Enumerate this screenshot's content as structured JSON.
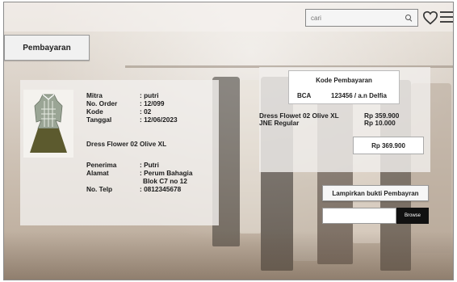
{
  "header": {
    "search_placeholder": "cari",
    "icons": [
      "search-icon",
      "heart-icon",
      "menu-icon"
    ]
  },
  "page_tab": {
    "label": "Pembayaran"
  },
  "order": {
    "fields": [
      {
        "label": "Mitra",
        "value": ": putri"
      },
      {
        "label": "No. Order",
        "value": ": 12/099"
      },
      {
        "label": "Kode",
        "value": ": 02"
      },
      {
        "label": "Tanggal",
        "value": ": 12/06/2023"
      }
    ],
    "product_name": "Dress Flower 02 Olive XL",
    "recipient": [
      {
        "label": "Penerima",
        "value": ": Putri"
      },
      {
        "label": "Alamat",
        "value": ": Perum Bahagia"
      },
      {
        "label": "",
        "value": "Blok C7 no 12"
      },
      {
        "label": "No. Telp",
        "value": ": 0812345678"
      }
    ]
  },
  "payment": {
    "code_title": "Kode Pembayaran",
    "bank": "BCA",
    "account": "123456 / a.n Delfia",
    "lines": [
      {
        "name": "Dress Flowet 02 Olive XL",
        "price": "Rp 359.900"
      },
      {
        "name": "JNE Regular",
        "price": "Rp 10.000"
      }
    ],
    "total": "Rp 369.900"
  },
  "upload": {
    "attach_label": "Lampirkan bukti Pembayran",
    "browse_label": "Browse"
  }
}
